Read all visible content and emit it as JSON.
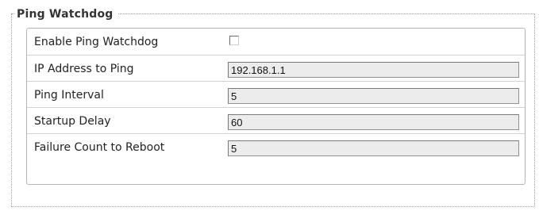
{
  "section": {
    "title": "Ping Watchdog"
  },
  "rows": [
    {
      "label": "Enable Ping Watchdog",
      "type": "checkbox",
      "checked": false
    },
    {
      "label": "IP Address to Ping",
      "type": "text",
      "value": "192.168.1.1"
    },
    {
      "label": "Ping Interval",
      "type": "text",
      "value": "5"
    },
    {
      "label": "Startup Delay",
      "type": "text",
      "value": "60"
    },
    {
      "label": "Failure Count to Reboot",
      "type": "text",
      "value": "5"
    }
  ]
}
